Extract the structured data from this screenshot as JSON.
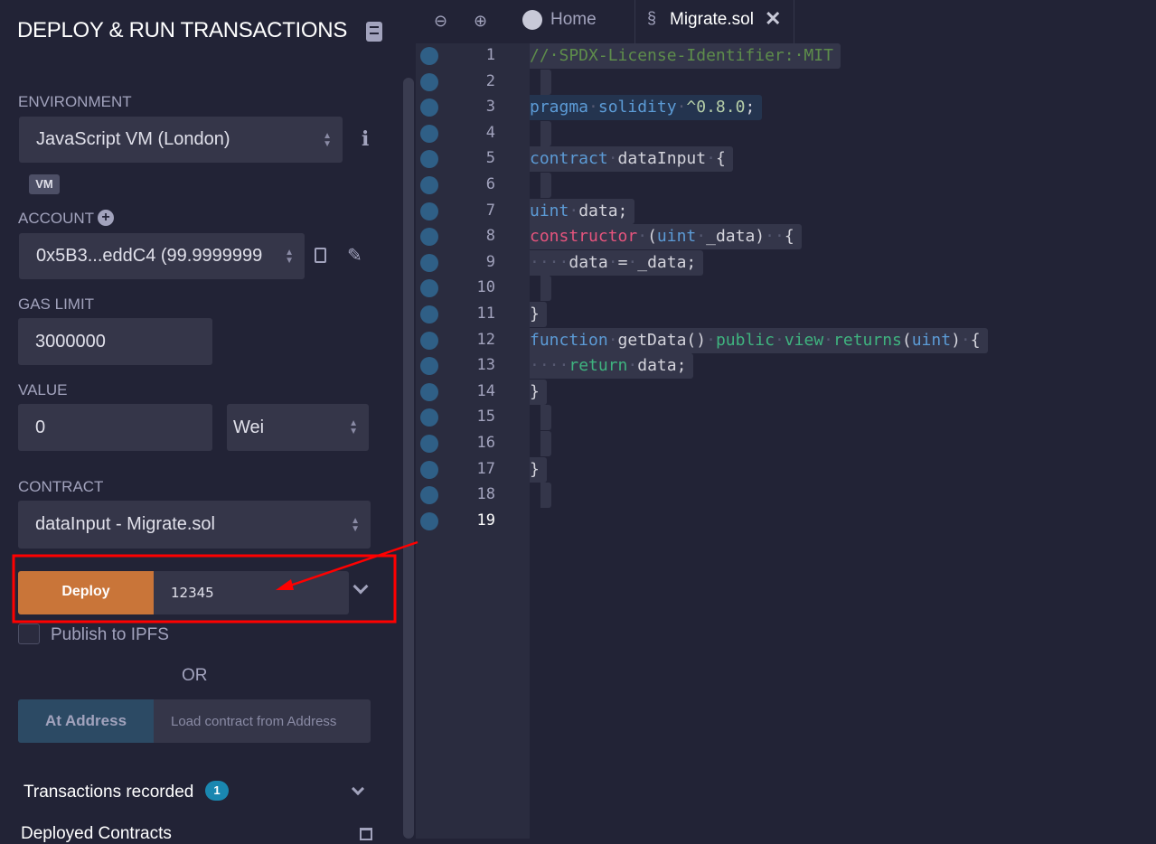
{
  "sidebar": {
    "title": "DEPLOY & RUN TRANSACTIONS",
    "environment_label": "ENVIRONMENT",
    "environment_value": "JavaScript VM (London)",
    "vm_badge": "VM",
    "account_label": "ACCOUNT",
    "account_value": "0x5B3...eddC4 (99.9999999",
    "gas_limit_label": "GAS LIMIT",
    "gas_limit_value": "3000000",
    "value_label": "VALUE",
    "value_value": "0",
    "value_unit": "Wei",
    "contract_label": "CONTRACT",
    "contract_value": "dataInput - Migrate.sol",
    "deploy_label": "Deploy",
    "deploy_args": "12345",
    "publish_label": "Publish to IPFS",
    "or_label": "OR",
    "at_address_label": "At Address",
    "at_address_placeholder": "Load contract from Address",
    "transactions_label": "Transactions recorded",
    "transactions_count": "1",
    "deployed_label": "Deployed Contracts"
  },
  "tabs": {
    "home": "Home",
    "file": "Migrate.sol"
  },
  "colors": {
    "deploy": "#c97539",
    "at_address": "#2c4a64",
    "annotation": "#ff0000",
    "badge": "#1a87b0"
  },
  "code": [
    [
      [
        "//·SPDX-License-Identifier:·MIT",
        "cm"
      ]
    ],
    [],
    [
      [
        "pragma",
        "kw"
      ],
      [
        "·",
        "ws"
      ],
      [
        "solidity",
        "kw"
      ],
      [
        "·",
        "ws"
      ],
      [
        "^0.8.0",
        "num"
      ],
      [
        ";",
        "id"
      ]
    ],
    [],
    [
      [
        "contract",
        "kw"
      ],
      [
        "·",
        "ws"
      ],
      [
        "dataInput",
        "id"
      ],
      [
        "·",
        "ws"
      ],
      [
        "{",
        "id"
      ]
    ],
    [],
    [
      [
        "uint",
        "kw"
      ],
      [
        "·",
        "ws"
      ],
      [
        "data;",
        "id"
      ]
    ],
    [
      [
        "constructor",
        "pk"
      ],
      [
        "·",
        "ws"
      ],
      [
        "(",
        "id"
      ],
      [
        "uint",
        "kw"
      ],
      [
        "·",
        "ws"
      ],
      [
        "_data)",
        "id"
      ],
      [
        "··",
        "ws"
      ],
      [
        "{",
        "id"
      ]
    ],
    [
      [
        "····",
        "ws"
      ],
      [
        "data",
        "id"
      ],
      [
        "·",
        "ws"
      ],
      [
        "=",
        "id"
      ],
      [
        "·",
        "ws"
      ],
      [
        "_data;",
        "id"
      ]
    ],
    [],
    [
      [
        "}",
        "id"
      ]
    ],
    [
      [
        "function",
        "kw"
      ],
      [
        "·",
        "ws"
      ],
      [
        "getData()",
        "id"
      ],
      [
        "·",
        "ws"
      ],
      [
        "public",
        "gr"
      ],
      [
        "·",
        "ws"
      ],
      [
        "view",
        "gr"
      ],
      [
        "·",
        "ws"
      ],
      [
        "returns",
        "gr"
      ],
      [
        "(",
        "id"
      ],
      [
        "uint",
        "kw"
      ],
      [
        ")",
        "id"
      ],
      [
        "·",
        "ws"
      ],
      [
        "{",
        "id"
      ]
    ],
    [
      [
        "····",
        "ws"
      ],
      [
        "return",
        "gr"
      ],
      [
        "·",
        "ws"
      ],
      [
        "data;",
        "id"
      ]
    ],
    [
      [
        "}",
        "id"
      ]
    ],
    [],
    [],
    [
      [
        "}",
        "id"
      ]
    ],
    [],
    null
  ]
}
